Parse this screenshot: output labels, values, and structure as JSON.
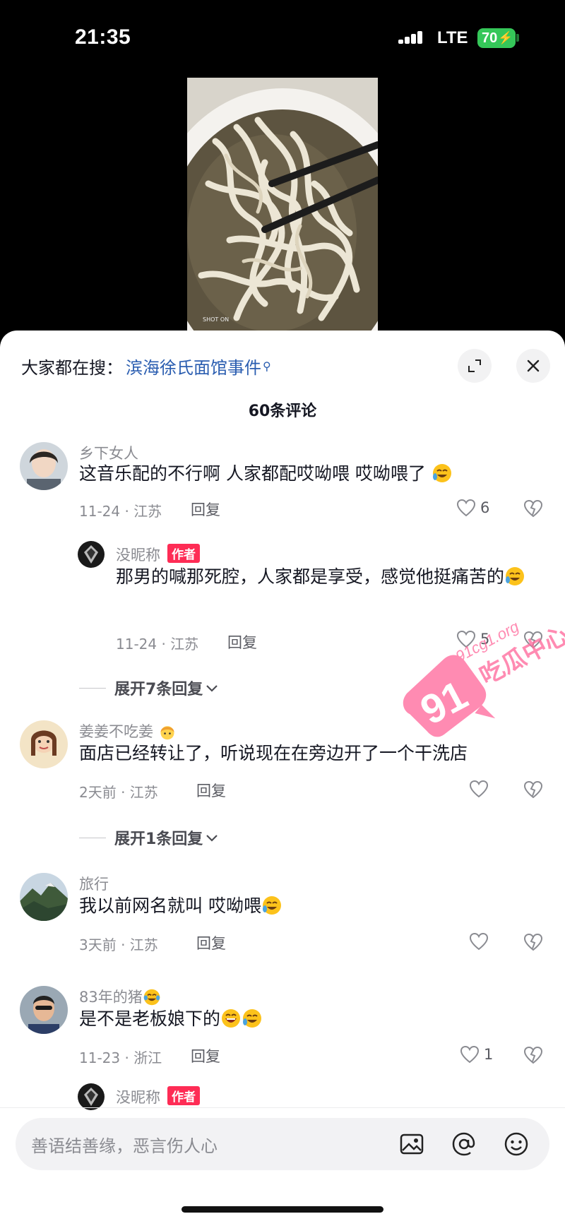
{
  "status_bar": {
    "time": "21:35",
    "network": "LTE",
    "battery": "70"
  },
  "sheet": {
    "search_prefix": "大家都在搜：",
    "search_term": "滨海徐氏面馆事件",
    "comment_count": "60条评论"
  },
  "comments": [
    {
      "username": "乡下女人",
      "text": "这音乐配的不行啊 人家都配哎呦喂 哎呦喂了",
      "date_location": "11-24 · 江苏",
      "reply_label": "回复",
      "likes": "6"
    },
    {
      "username": "没昵称",
      "author_badge": "作者",
      "text": "那男的喊那死腔，人家都是享受，感觉他挺痛苦的",
      "date_location": "11-24 · 江苏",
      "reply_label": "回复",
      "likes": "5"
    },
    {
      "expand_label": "展开7条回复"
    },
    {
      "username": "姜姜不吃姜",
      "text": "面店已经转让了，听说现在在旁边开了一个干洗店",
      "date_location": "2天前 · 江苏",
      "reply_label": "回复",
      "likes": ""
    },
    {
      "expand_label": "展开1条回复"
    },
    {
      "username": "旅行",
      "text": "我以前网名就叫 哎呦喂",
      "date_location": "3天前 · 江苏",
      "reply_label": "回复",
      "likes": ""
    },
    {
      "username": "83年的猪",
      "text": "是不是老板娘下的",
      "date_location": "11-23 · 浙江",
      "reply_label": "回复",
      "likes": "1"
    },
    {
      "username": "没昵称",
      "author_badge": "作者"
    }
  ],
  "watermark": {
    "number": "91",
    "domain": "91cg1.org",
    "name": "吃瓜中心"
  },
  "input_bar": {
    "placeholder": "善语结善缘，恶言伤人心"
  }
}
